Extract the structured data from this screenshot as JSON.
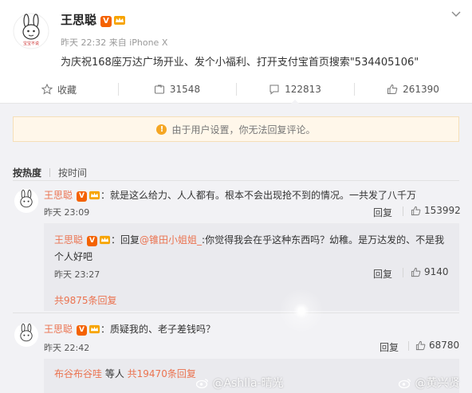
{
  "post": {
    "author": "王思聪",
    "verified_badge": "V",
    "time": "昨天 22:32",
    "source": "来自 iPhone X",
    "text": "为庆祝168座万达广场开业、发个小福利、打开支付宝首页搜索\"534405106\""
  },
  "actions": {
    "favorite": "收藏",
    "repost": "31548",
    "comment": "122813",
    "like": "261390"
  },
  "notice": "由于用户设置，你无法回复评论。",
  "sort": {
    "hot": "按热度",
    "time": "按时间"
  },
  "comments": [
    {
      "name": "王思聪",
      "text": "：就是这么给力、人人都有。根本不会出现抢不到的情况。一共发了八千万",
      "time": "昨天 23:09",
      "reply_label": "回复",
      "likes": "153992",
      "sub_reply": {
        "name": "王思聪",
        "prefix": "：回复",
        "mention": "@锥田小姐姐_",
        "text_line1": ":你觉得我会在乎这种东西吗？幼稚。是万达发的、不是我",
        "text_line2": "个人好吧",
        "time": "昨天 23:27",
        "reply_label": "回复",
        "likes": "9140"
      },
      "more_replies": "共9875条回复"
    },
    {
      "name": "王思聪",
      "text": "：质疑我的、老子差钱吗？",
      "time": "昨天 22:42",
      "reply_label": "回复",
      "likes": "68780",
      "sub_preview": {
        "names": "布谷布谷哇",
        "middle": " 等人 ",
        "count": "共19470条回复"
      }
    }
  ],
  "watermarks": {
    "left": "@Ashlla-晴光",
    "right": "@黄兴贤"
  },
  "colors": {
    "accent_orange": "#eb7350",
    "verified_orange": "#f46200",
    "notice_bg": "#fff7ea",
    "page_bg": "#f2f2f5"
  }
}
